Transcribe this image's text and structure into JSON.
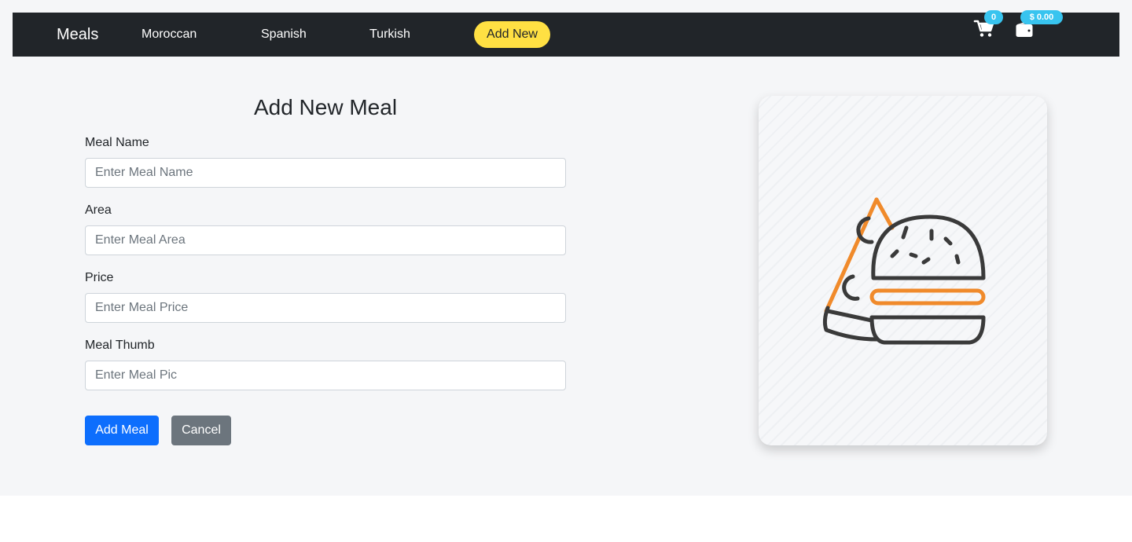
{
  "navbar": {
    "brand": "Meals",
    "links": [
      {
        "label": "Moroccan"
      },
      {
        "label": "Spanish"
      },
      {
        "label": "Turkish"
      }
    ],
    "add_new_label": "Add New",
    "cart_icon": "cart-icon",
    "cart_count": "0",
    "wallet_icon": "wallet-icon",
    "wallet_balance": "$ 0.00",
    "colors": {
      "background": "#212529",
      "accent": "#ffe043",
      "badge": "#38c4ef"
    }
  },
  "form": {
    "title": "Add New Meal",
    "fields": [
      {
        "label": "Meal Name",
        "placeholder": "Enter Meal Name",
        "value": ""
      },
      {
        "label": "Area",
        "placeholder": "Enter Meal Area",
        "value": ""
      },
      {
        "label": "Price",
        "placeholder": "Enter Meal Price",
        "value": ""
      },
      {
        "label": "Meal Thumb",
        "placeholder": "Enter Meal Pic",
        "value": ""
      }
    ],
    "submit_label": "Add Meal",
    "cancel_label": "Cancel",
    "colors": {
      "primary": "#0d6efd",
      "secondary": "#6c757d"
    }
  },
  "illustration": {
    "icon": "pizza-burger-icon",
    "colors": {
      "outline": "#3a3a3a",
      "accent": "#f08a2b"
    }
  }
}
